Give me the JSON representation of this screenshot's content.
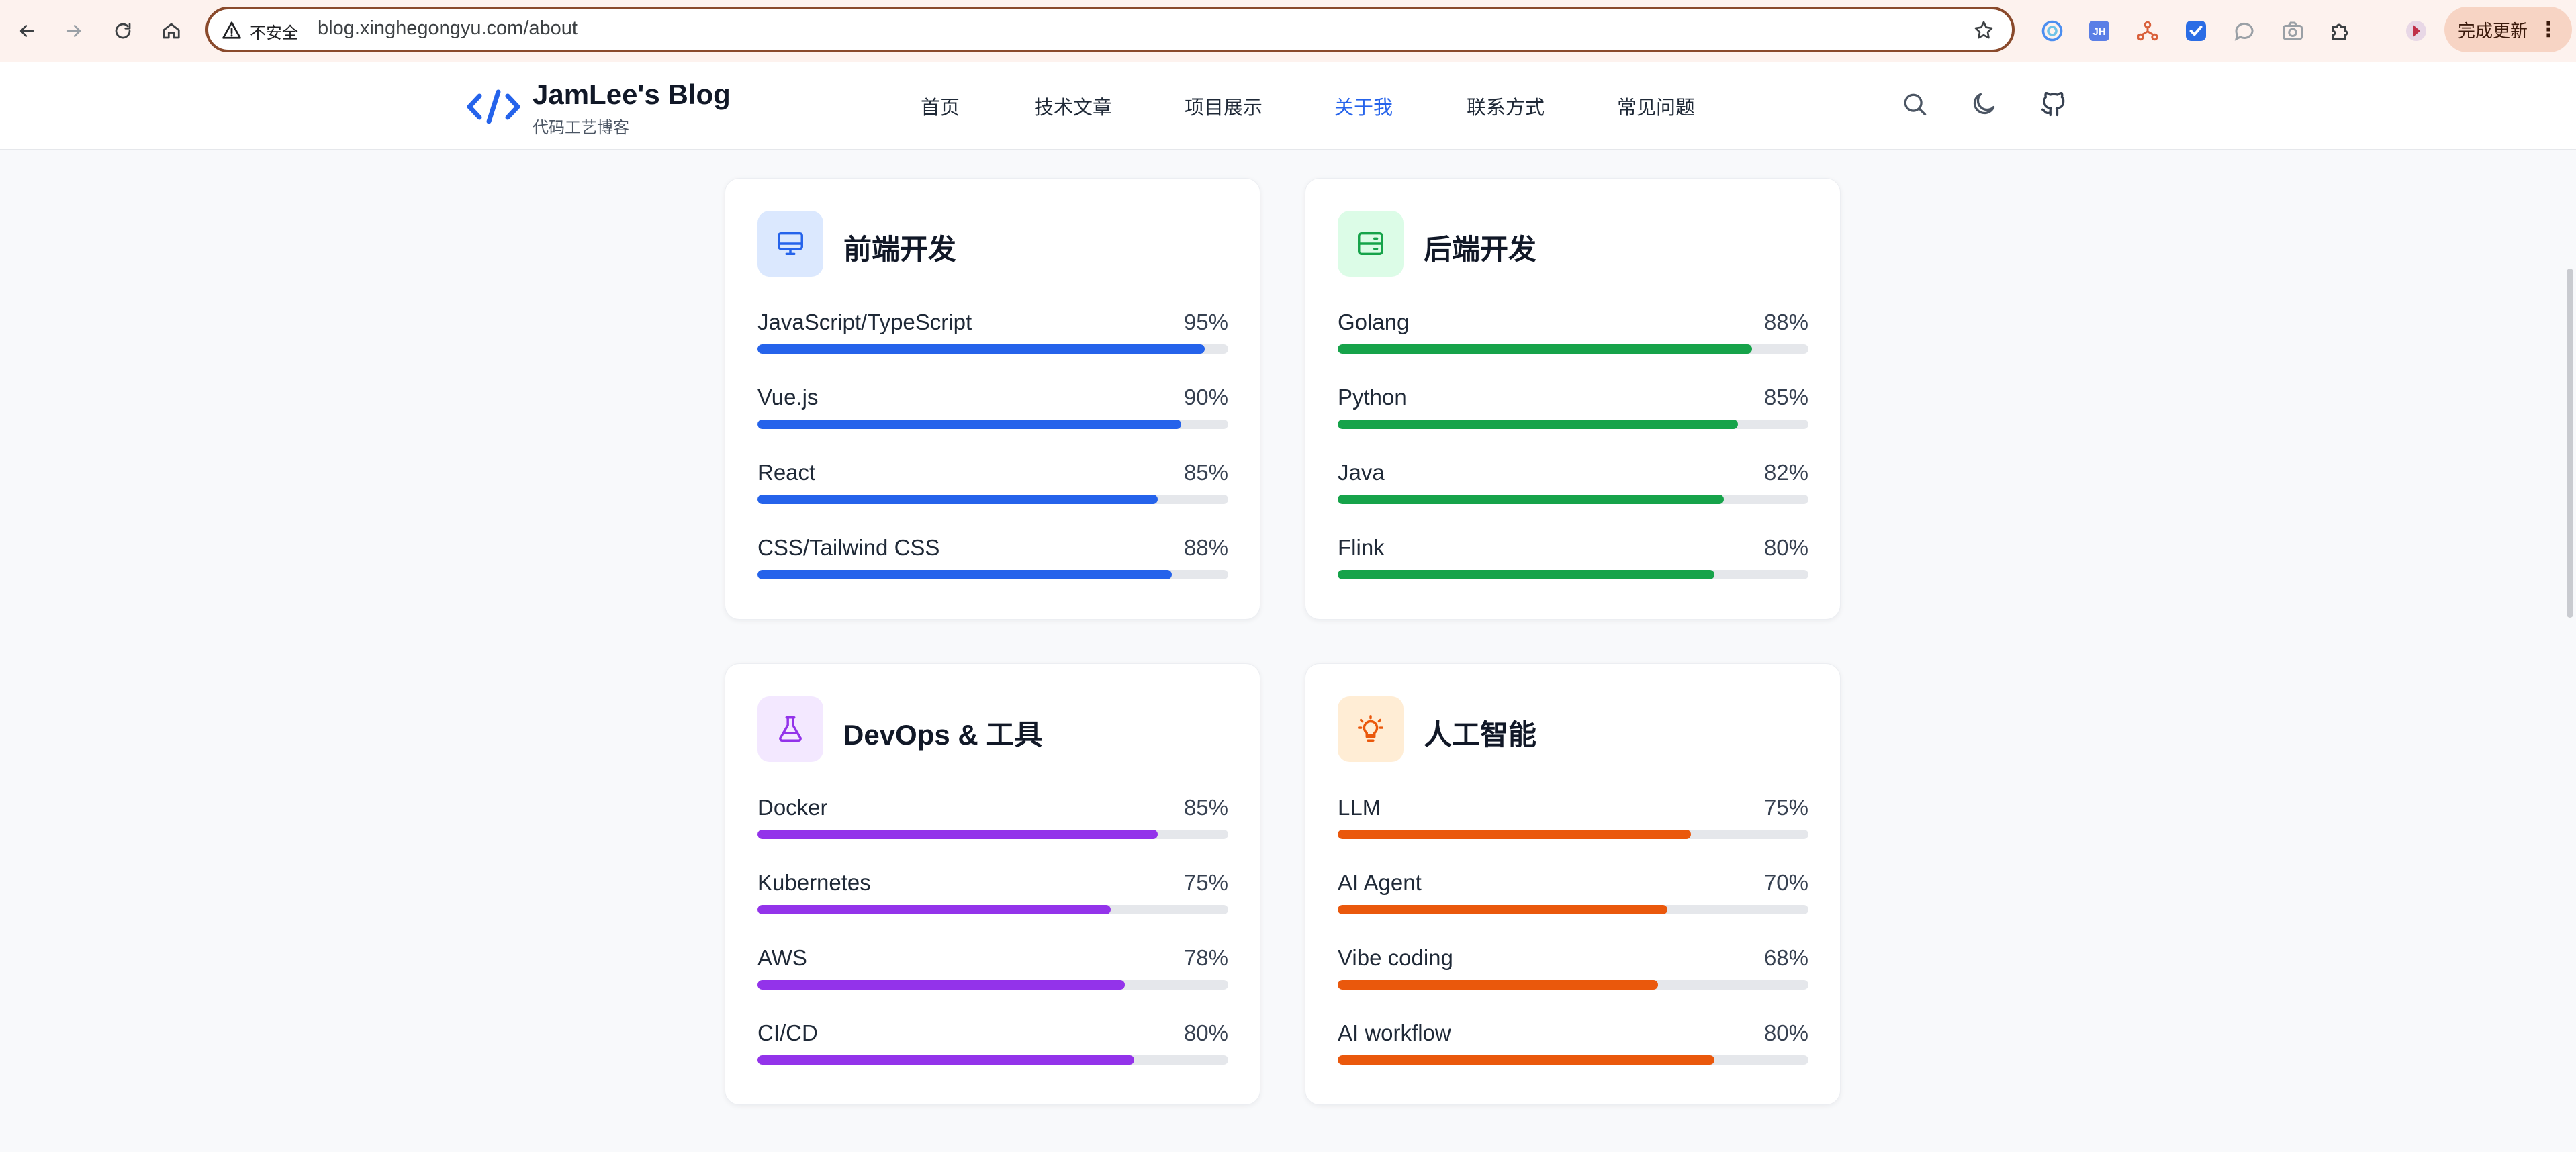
{
  "browser": {
    "security_label": "不安全",
    "url": "blog.xinghegongyu.com/about",
    "update_button": "完成更新",
    "update_menu": "⋮",
    "extensions": [
      "copilot-icon",
      "jh-extension-icon",
      "network-icon",
      "checkmark-extension-icon",
      "chat-bubble-icon",
      "camera-icon",
      "puzzle-icon",
      "profile-avatar"
    ]
  },
  "site": {
    "logo": "</>",
    "title": "JamLee's Blog",
    "subtitle": "代码工艺博客",
    "nav": [
      {
        "label": "首页",
        "active": false
      },
      {
        "label": "技术文章",
        "active": false
      },
      {
        "label": "项目展示",
        "active": false
      },
      {
        "label": "关于我",
        "active": true
      },
      {
        "label": "联系方式",
        "active": false
      },
      {
        "label": "常见问题",
        "active": false
      }
    ],
    "icons": [
      "search-icon",
      "moon-icon",
      "github-icon"
    ]
  },
  "cards": [
    {
      "title": "前端开发",
      "icon": "monitor-icon",
      "color": "#2563eb",
      "icon_bg": "#dbe8fe",
      "skills": [
        {
          "name": "JavaScript/TypeScript",
          "percent": "95%",
          "value": 95
        },
        {
          "name": "Vue.js",
          "percent": "90%",
          "value": 90
        },
        {
          "name": "React",
          "percent": "85%",
          "value": 85
        },
        {
          "name": "CSS/Tailwind CSS",
          "percent": "88%",
          "value": 88
        }
      ]
    },
    {
      "title": "后端开发",
      "icon": "server-icon",
      "color": "#16a34a",
      "icon_bg": "#dcfce7",
      "skills": [
        {
          "name": "Golang",
          "percent": "88%",
          "value": 88
        },
        {
          "name": "Python",
          "percent": "85%",
          "value": 85
        },
        {
          "name": "Java",
          "percent": "82%",
          "value": 82
        },
        {
          "name": "Flink",
          "percent": "80%",
          "value": 80
        }
      ]
    },
    {
      "title": "DevOps & 工具",
      "icon": "flask-icon",
      "color": "#9333ea",
      "icon_bg": "#f3e8ff",
      "skills": [
        {
          "name": "Docker",
          "percent": "85%",
          "value": 85
        },
        {
          "name": "Kubernetes",
          "percent": "75%",
          "value": 75
        },
        {
          "name": "AWS",
          "percent": "78%",
          "value": 78
        },
        {
          "name": "CI/CD",
          "percent": "80%",
          "value": 80
        }
      ]
    },
    {
      "title": "人工智能",
      "icon": "lightbulb-icon",
      "color": "#ea580c",
      "icon_bg": "#ffedd5",
      "skills": [
        {
          "name": "LLM",
          "percent": "75%",
          "value": 75
        },
        {
          "name": "AI Agent",
          "percent": "70%",
          "value": 70
        },
        {
          "name": "Vibe coding",
          "percent": "68%",
          "value": 68
        },
        {
          "name": "AI workflow",
          "percent": "80%",
          "value": 80
        }
      ]
    }
  ]
}
